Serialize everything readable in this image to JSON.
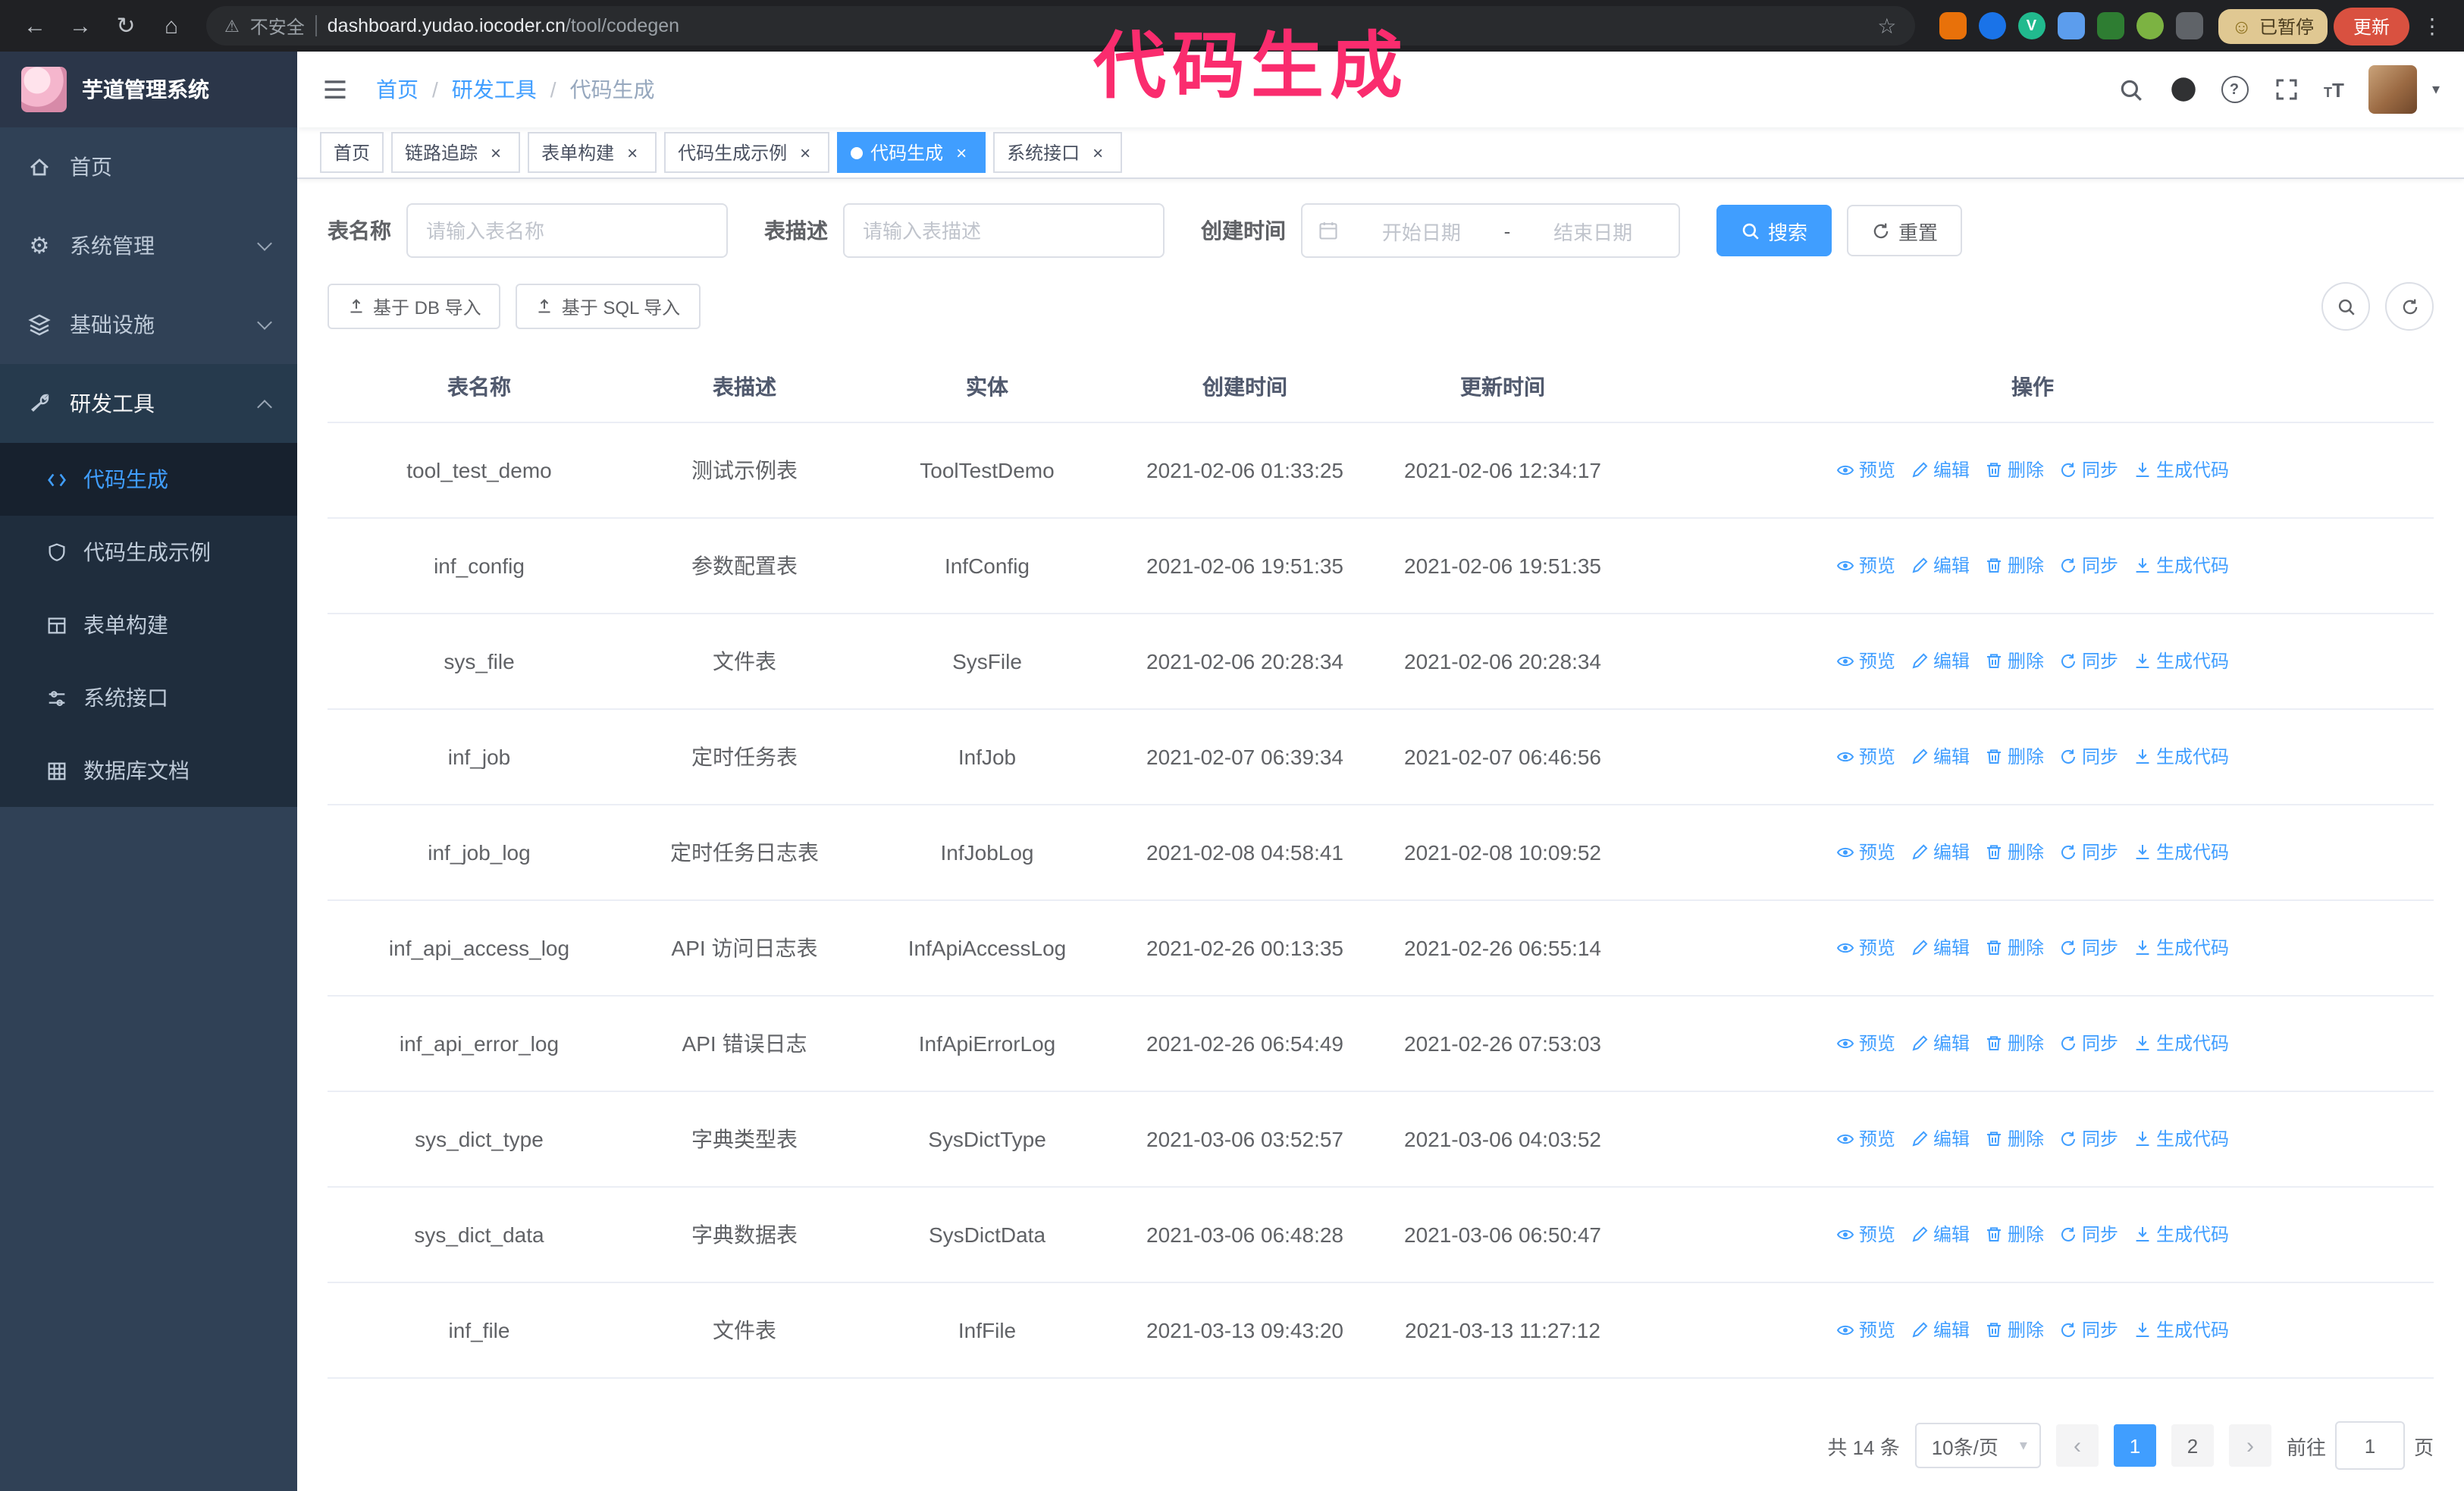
{
  "annotation": {
    "text": "代码生成"
  },
  "browser": {
    "security_label": "不安全",
    "url_host": "dashboard.yudao.iocoder.cn",
    "url_path": "/tool/codegen",
    "paused_badge": "已暂停",
    "update_button": "更新",
    "devtools_badge": "V"
  },
  "glyphs": {
    "back": "←",
    "forward": "→",
    "reload": "↻",
    "home": "⌂",
    "warning": "⚠",
    "star": "☆",
    "menu_dots": "⋮",
    "smiley": "☺",
    "caret": "▾",
    "close": "×",
    "prev": "‹",
    "next": "›",
    "question": "?",
    "gear": "⚙",
    "t_big": "T",
    "t_small": "T"
  },
  "sidebar": {
    "logo_title": "芋道管理系统",
    "items": [
      {
        "label": "首页",
        "expandable": false
      },
      {
        "label": "系统管理",
        "expandable": true,
        "expanded": false
      },
      {
        "label": "基础设施",
        "expandable": true,
        "expanded": false
      },
      {
        "label": "研发工具",
        "expandable": true,
        "expanded": true
      }
    ],
    "submenu": [
      {
        "label": "代码生成",
        "active": true
      },
      {
        "label": "代码生成示例",
        "active": false
      },
      {
        "label": "表单构建",
        "active": false
      },
      {
        "label": "系统接口",
        "active": false
      },
      {
        "label": "数据库文档",
        "active": false
      }
    ]
  },
  "header": {
    "breadcrumb": [
      "首页",
      "研发工具",
      "代码生成"
    ]
  },
  "tabs": [
    {
      "label": "首页",
      "closable": false,
      "active": false
    },
    {
      "label": "链路追踪",
      "closable": true,
      "active": false
    },
    {
      "label": "表单构建",
      "closable": true,
      "active": false
    },
    {
      "label": "代码生成示例",
      "closable": true,
      "active": false
    },
    {
      "label": "代码生成",
      "closable": true,
      "active": true
    },
    {
      "label": "系统接口",
      "closable": true,
      "active": false
    }
  ],
  "filters": {
    "table_name_label": "表名称",
    "table_name_placeholder": "请输入表名称",
    "table_desc_label": "表描述",
    "table_desc_placeholder": "请输入表描述",
    "create_time_label": "创建时间",
    "date_start_placeholder": "开始日期",
    "date_separator": "-",
    "date_end_placeholder": "结束日期",
    "search_button": "搜索",
    "reset_button": "重置"
  },
  "toolbar": {
    "import_db": "基于 DB 导入",
    "import_sql": "基于 SQL 导入"
  },
  "table": {
    "columns": [
      "表名称",
      "表描述",
      "实体",
      "创建时间",
      "更新时间",
      "操作"
    ],
    "actions": [
      "预览",
      "编辑",
      "删除",
      "同步",
      "生成代码"
    ],
    "rows": [
      {
        "name": "tool_test_demo",
        "desc": "测试示例表",
        "entity": "ToolTestDemo",
        "created": "2021-02-06 01:33:25",
        "updated": "2021-02-06 12:34:17"
      },
      {
        "name": "inf_config",
        "desc": "参数配置表",
        "entity": "InfConfig",
        "created": "2021-02-06 19:51:35",
        "updated": "2021-02-06 19:51:35"
      },
      {
        "name": "sys_file",
        "desc": "文件表",
        "entity": "SysFile",
        "created": "2021-02-06 20:28:34",
        "updated": "2021-02-06 20:28:34"
      },
      {
        "name": "inf_job",
        "desc": "定时任务表",
        "entity": "InfJob",
        "created": "2021-02-07 06:39:34",
        "updated": "2021-02-07 06:46:56"
      },
      {
        "name": "inf_job_log",
        "desc": "定时任务日志表",
        "entity": "InfJobLog",
        "created": "2021-02-08 04:58:41",
        "updated": "2021-02-08 10:09:52"
      },
      {
        "name": "inf_api_access_log",
        "desc": "API 访问日志表",
        "entity": "InfApiAccessLog",
        "created": "2021-02-26 00:13:35",
        "updated": "2021-02-26 06:55:14"
      },
      {
        "name": "inf_api_error_log",
        "desc": "API 错误日志",
        "entity": "InfApiErrorLog",
        "created": "2021-02-26 06:54:49",
        "updated": "2021-02-26 07:53:03"
      },
      {
        "name": "sys_dict_type",
        "desc": "字典类型表",
        "entity": "SysDictType",
        "created": "2021-03-06 03:52:57",
        "updated": "2021-03-06 04:03:52"
      },
      {
        "name": "sys_dict_data",
        "desc": "字典数据表",
        "entity": "SysDictData",
        "created": "2021-03-06 06:48:28",
        "updated": "2021-03-06 06:50:47"
      },
      {
        "name": "inf_file",
        "desc": "文件表",
        "entity": "InfFile",
        "created": "2021-03-13 09:43:20",
        "updated": "2021-03-13 11:27:12"
      }
    ]
  },
  "pagination": {
    "total": "共 14 条",
    "page_size": "10条/页",
    "pages": [
      "1",
      "2"
    ],
    "active_page": "1",
    "goto_label": "前往",
    "goto_value": "1",
    "goto_suffix": "页"
  },
  "colors": {
    "primary": "#409eff",
    "sidebar_bg": "#304156",
    "submenu_bg": "#1f2d3d",
    "active_tab_bg": "#409eff",
    "annotation": "#fa2c6e",
    "update_button_bg": "#d95140",
    "paused_badge_bg": "#e0c892"
  }
}
